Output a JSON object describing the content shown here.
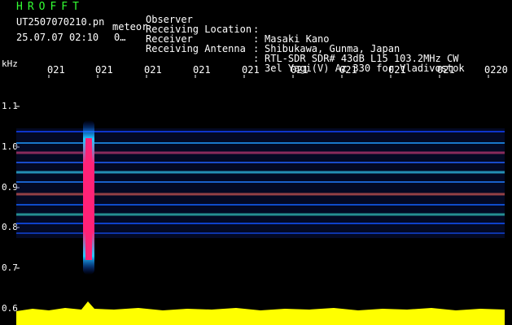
{
  "header": {
    "app_title": "HROFFT",
    "file_name": "UT2507070210.pn",
    "file_suffix": "meteor",
    "date_time": "25.07.07 02:10",
    "date_extra": "0…",
    "info": [
      {
        "label": "Observer",
        "sep": ":",
        "value": "Masaki Kano"
      },
      {
        "label": "Receiving Location",
        "sep": ":",
        "value": "Shibukawa, Gunma, Japan"
      },
      {
        "label": "Receiver",
        "sep": ":",
        "value": "RTL-SDR SDR# 43dB L15 103.2MHz CW"
      },
      {
        "label": "Receiving Antenna",
        "sep": ":",
        "value": "3el Yagi(V) Az 330 for Vladivostok"
      }
    ]
  },
  "axis": {
    "unit": "kHz",
    "time_labels": [
      "021",
      "021",
      "021",
      "021",
      "021",
      "021",
      "021",
      "021",
      "021",
      "0220"
    ],
    "y_ticks": [
      "1.1",
      "1.0",
      "0.9",
      "0.8",
      "0.7",
      "0.6"
    ]
  },
  "colors": {
    "background": "#000000",
    "title": "#33ff33",
    "meteor": "#ff2277",
    "level_bar": "#ffff00"
  }
}
